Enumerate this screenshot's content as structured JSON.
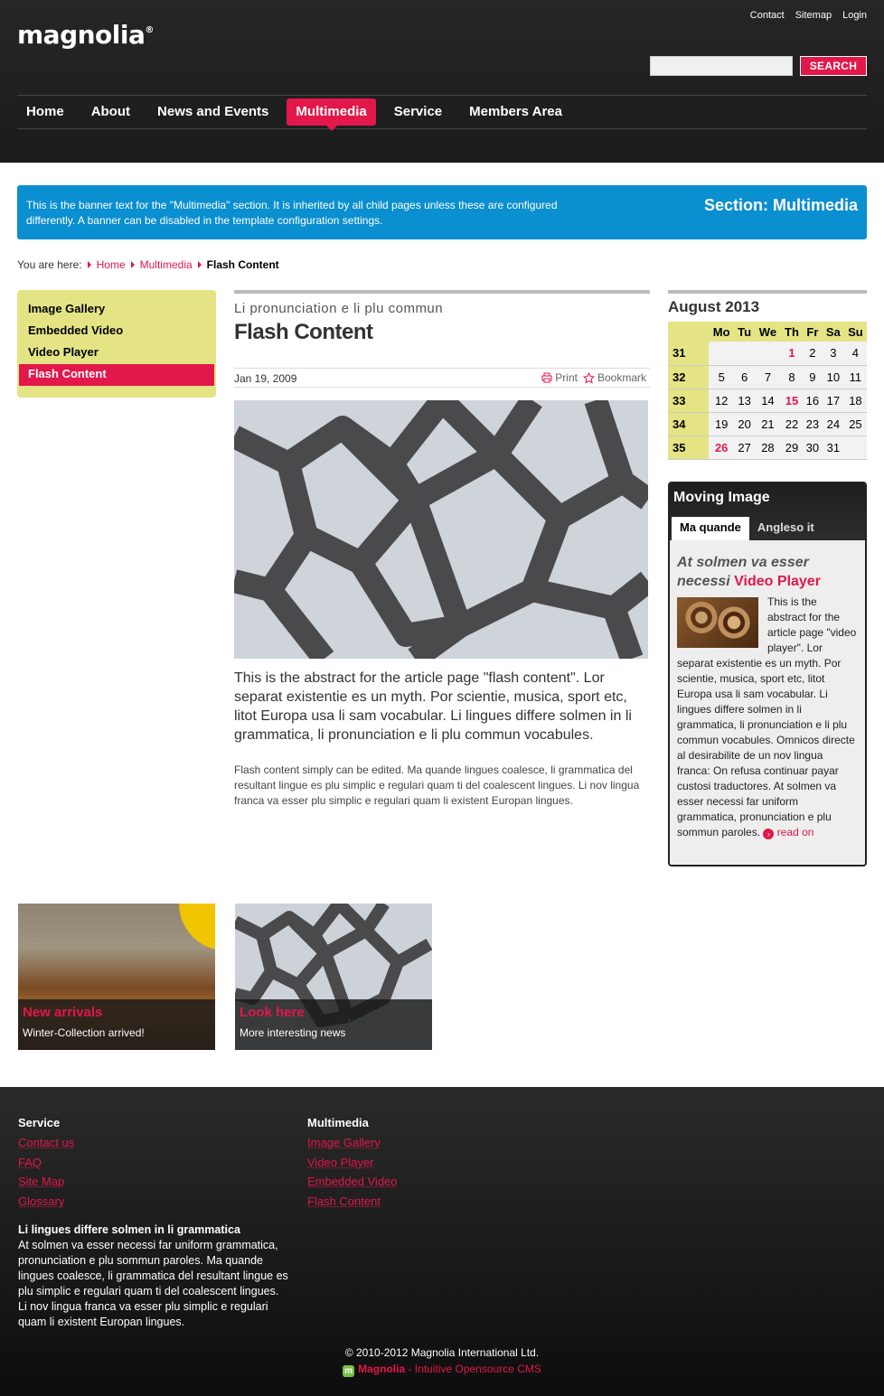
{
  "header": {
    "utility": [
      "Contact",
      "Sitemap",
      "Login"
    ],
    "logo_text": "magnolia",
    "logo_mark": "®",
    "search": {
      "placeholder": "",
      "button": "SEARCH"
    },
    "nav": [
      "Home",
      "About",
      "News and Events",
      "Multimedia",
      "Service",
      "Members Area"
    ],
    "active_nav": "Multimedia"
  },
  "banner": {
    "text": "This is the banner text for the \"Multimedia\" section. It is inherited by all child pages unless these are configured differently. A banner can be disabled in the template configuration settings.",
    "section": "Section: Multimedia"
  },
  "breadcrumb": {
    "label": "You are here:",
    "items": [
      "Home",
      "Multimedia"
    ],
    "current": "Flash Content"
  },
  "subnav": {
    "items": [
      "Image Gallery",
      "Embedded Video",
      "Video Player",
      "Flash Content"
    ],
    "active": "Flash Content"
  },
  "article": {
    "kicker": "Li pronunciation e li plu commun",
    "title": "Flash Content",
    "date": "Jan 19, 2009",
    "print": "Print",
    "bookmark": "Bookmark",
    "abstract": "This is the abstract for the article page \"flash content\". Lor separat existentie es un myth. Por scientie, musica, sport etc, litot Europa usa li sam vocabular. Li lingues differe solmen in li grammatica, li pronunciation e li plu commun vocabules.",
    "body": "Flash content simply can be edited. Ma quande lingues coalesce, li grammatica del resultant lingue es plu simplic e regulari quam ti del coalescent lingues. Li nov lingua franca va esser plu simplic e regulari quam li existent Europan lingues."
  },
  "calendar": {
    "title": "August 2013",
    "days": [
      "Mo",
      "Tu",
      "We",
      "Th",
      "Fr",
      "Sa",
      "Su"
    ],
    "weeks": [
      {
        "week": "31",
        "days": [
          "",
          "",
          "",
          "1",
          "2",
          "3",
          "4"
        ]
      },
      {
        "week": "32",
        "days": [
          "5",
          "6",
          "7",
          "8",
          "9",
          "10",
          "11"
        ]
      },
      {
        "week": "33",
        "days": [
          "12",
          "13",
          "14",
          "15",
          "16",
          "17",
          "18"
        ]
      },
      {
        "week": "34",
        "days": [
          "19",
          "20",
          "21",
          "22",
          "23",
          "24",
          "25"
        ]
      },
      {
        "week": "35",
        "days": [
          "26",
          "27",
          "28",
          "29",
          "30",
          "31",
          ""
        ]
      }
    ],
    "highlighted": [
      "1",
      "15",
      "26"
    ]
  },
  "teaser": {
    "title": "Moving Image",
    "tabs": [
      "Ma quande",
      "Angleso it"
    ],
    "heading": "At solmen va esser necessi",
    "heading_link": "Video Player",
    "text": "This is the abstract for the article page \"video player\". Lor separat existentie es un myth. Por scientie, musica, sport etc, litot Europa usa li sam vocabular. Li lingues differe solmen in li grammatica, li pronunciation e li plu commun vocabules. Omnicos directe al desirabilite de un nov lingua franca: On refusa continuar payar custosi traductores. At solmen va esser necessi far uniform grammatica, pronunciation e plu sommun paroles.",
    "read_on": "read on"
  },
  "promos": [
    {
      "title": "New arrivals",
      "subtitle": "Winter-Collection arrived!"
    },
    {
      "title": "Look here",
      "subtitle": "More interesting news"
    }
  ],
  "footer": {
    "col1": {
      "title": "Service",
      "links": [
        "Contact us",
        "FAQ",
        "Site Map",
        "Glossary"
      ]
    },
    "col2": {
      "title": "Multimedia",
      "links": [
        "Image Gallery",
        "Video Player",
        "Embedded Video",
        "Flash Content"
      ]
    },
    "about_title": "Li lingues differe solmen in li grammatica",
    "about_text": "At solmen va esser necessi far uniform grammatica, pronunciation e plu sommun paroles. Ma quande lingues coalesce, li grammatica del resultant lingue es plu simplic e regulari quam ti del coalescent lingues. Li nov lingua franca va esser plu simplic e regulari quam li existent Europan lingues.",
    "copyright": "© 2010-2012 Magnolia International Ltd.",
    "powered_name": "Magnolia",
    "powered_tagline": " - Intuitive Opensource CMS"
  },
  "colors": {
    "accent": "#e2174a",
    "banner": "#0a8fd0",
    "highlight": "#e4e484"
  }
}
